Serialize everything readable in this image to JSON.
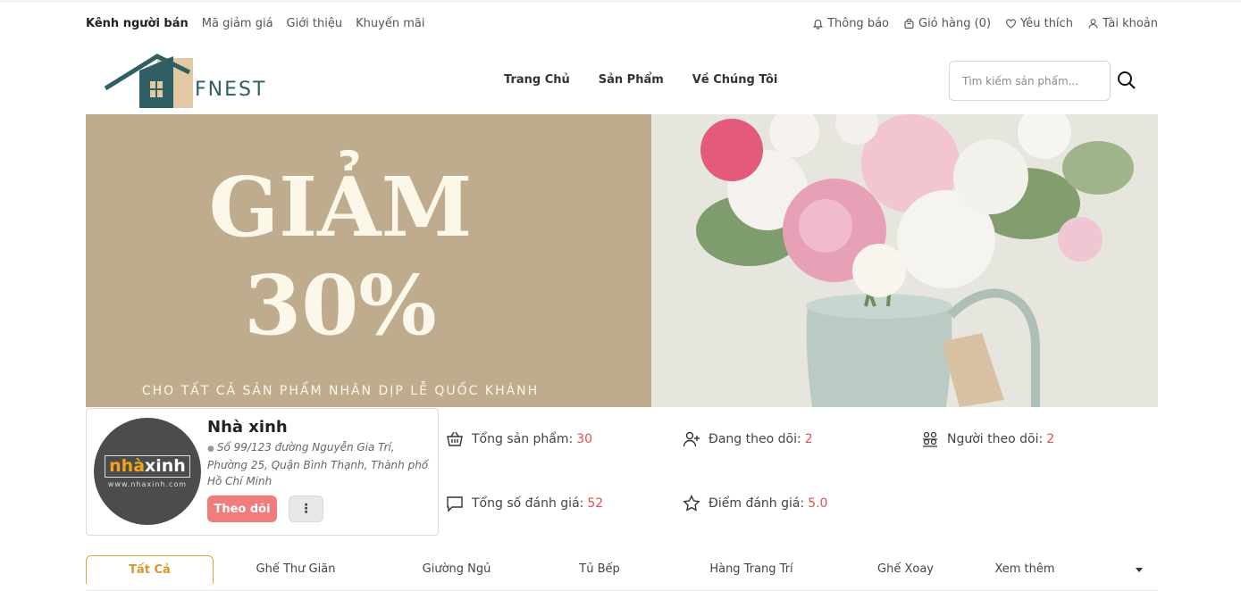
{
  "topbar": {
    "left": [
      "Kênh người bán",
      "Mã giảm giá",
      "Giới thiệu",
      "Khuyến mãi"
    ],
    "right": {
      "notifications": "Thông báo",
      "cart": "Giỏ hàng (0)",
      "favorites": "Yêu thích",
      "account": "Tài khoản"
    }
  },
  "header": {
    "logo_text": "FNEST",
    "nav": [
      "Trang Chủ",
      "Sản Phẩm",
      "Về Chúng Tôi"
    ],
    "search_placeholder": "Tìm kiếm sản phẩm..."
  },
  "banner": {
    "line1": "GIẢM",
    "line2": "30%",
    "subtitle": "CHO TẤT CẢ SẢN PHẨM NHÂN DỊP LỄ QUỐC KHÁNH"
  },
  "shop": {
    "logo_brand_1": "nhà",
    "logo_brand_2": "xinh",
    "logo_site": "www.nhaxinh.com",
    "name": "Nhà xinh",
    "address": "Số 99/123 đường Nguyễn Gia Trí, Phường 25, Quận Bình Thạnh, Thành phố Hồ Chí Minh",
    "follow_label": "Theo dõi",
    "more_label": "⋮"
  },
  "stats": {
    "total_products": {
      "label": "Tổng sản phẩm:",
      "value": "30"
    },
    "following": {
      "label": "Đang theo dõi:",
      "value": "2"
    },
    "followers": {
      "label": "Người theo dõi:",
      "value": "2"
    },
    "total_reviews": {
      "label": "Tổng số đánh giá:",
      "value": "52"
    },
    "rating": {
      "label": "Điểm đánh giá:",
      "value": "5.0"
    }
  },
  "tabs": [
    "Tất Cả",
    "Ghế Thư Giãn",
    "Giường Ngủ",
    "Tủ Bếp",
    "Hàng Trang Trí",
    "Ghế Xoay",
    "Xem thêm"
  ],
  "colors": {
    "banner_bg": "#bfab8e",
    "accent_tab": "#d9962c",
    "follow_button": "#f07c7c",
    "stat_value": "#e05050",
    "logo_teal": "#2f5f63"
  }
}
